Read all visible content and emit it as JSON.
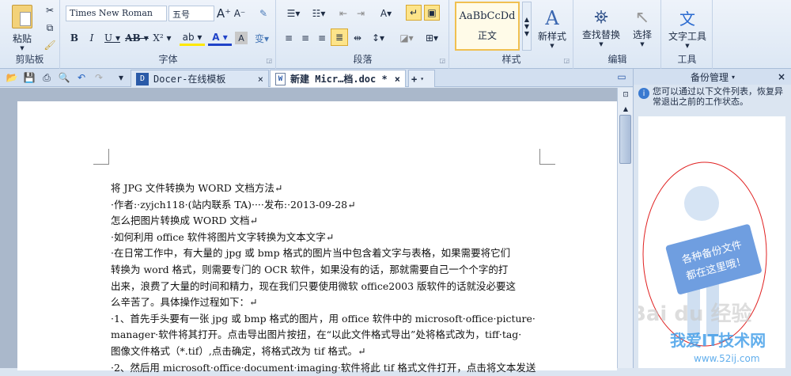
{
  "ribbon": {
    "clipboard": {
      "paste": "粘贴",
      "label": "剪贴板"
    },
    "font": {
      "name": "Times New Roman",
      "size": "五号",
      "label": "字体"
    },
    "paragraph": {
      "label": "段落"
    },
    "styles": {
      "preview": "AaBbCcDd",
      "normal": "正文",
      "new_style": "新样式",
      "label": "样式"
    },
    "editing": {
      "find_replace": "查找替换",
      "select": "选择",
      "label": "编辑"
    },
    "tools": {
      "text_tools": "文字工具",
      "label": "工具"
    }
  },
  "tabs": [
    {
      "label": "Docer-在线模板"
    },
    {
      "label": "新建 Micr…档.doc *"
    }
  ],
  "panel": {
    "title": "备份管理",
    "info": "您可以通过以下文件列表，恢复异常退出之前的工作状态。",
    "sign_line1": "各种备份文件",
    "sign_line2": "都在这里哦！"
  },
  "document": {
    "lines": [
      "将 JPG 文件转换为 WORD 文档方法↵",
      "·作者:·zyjch118·(站内联系 TA)····发布:·2013-09-28↵",
      "怎么把图片转换成 WORD 文档↵",
      "·如何利用 office 软件将图片文字转换为文本文字↵",
      "·在日常工作中，有大量的 jpg 或 bmp 格式的图片当中包含着文字与表格，如果需要将它们",
      "转换为 word 格式，则需要专门的 OCR 软件，如果没有的话，那就需要自己一个个字的打",
      "出来，浪费了大量的时间和精力，现在我们只要使用微软 office2003 版软件的话就没必要这",
      "么辛苦了。具体操作过程如下：↵",
      "·1、首先手头要有一张 jpg 或 bmp 格式的图片，用 office 软件中的 microsoft·office·picture·",
      "manager·软件将其打开。点击导出图片按扭，在“以此文件格式导出”处将格式改为，tiff·tag·",
      "图像文件格式（*.tif）,点击确定，将格式改为 tif 格式。↵",
      "·2、然后用 microsoft·office·document·imaging·软件将此 tif 格式文件打开，点击将文本发送"
    ]
  },
  "watermark": {
    "baidu": "Bai du 经验",
    "site": "我爱IT技术网",
    "url": "www.52ij.com"
  }
}
